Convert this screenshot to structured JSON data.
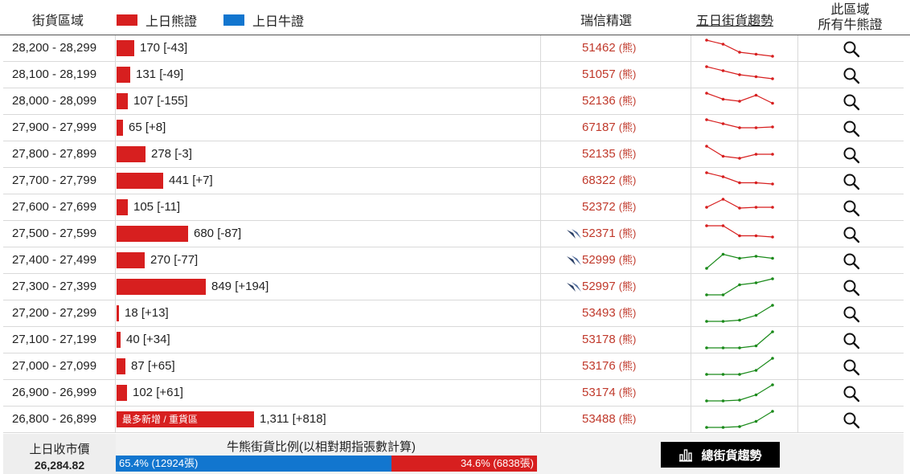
{
  "header": {
    "range_label": "街貨區域",
    "legend_bear": "上日熊證",
    "legend_bull": "上日牛證",
    "pick_label": "瑞信精選",
    "trend_label": "五日街貨趨勢",
    "all_line1": "此區域",
    "all_line2": "所有牛熊證"
  },
  "colors": {
    "bear": "#d71f1f",
    "bull": "#1276cf",
    "bear_trend": "#d71f1f",
    "bull_trend": "#1a8a1a"
  },
  "rows": [
    {
      "range": "28,200 - 28,299",
      "value": 170,
      "text": "170 [-43]",
      "code": "51462",
      "code_suffix": "(熊)",
      "bird": false,
      "trend": [
        5,
        4,
        2,
        1.5,
        1
      ],
      "trend_type": "bear"
    },
    {
      "range": "28,100 - 28,199",
      "value": 131,
      "text": "131 [-49]",
      "code": "51057",
      "code_suffix": "(熊)",
      "bird": false,
      "trend": [
        5,
        4,
        3,
        2.5,
        2
      ],
      "trend_type": "bear"
    },
    {
      "range": "28,000 - 28,099",
      "value": 107,
      "text": "107 [-155]",
      "code": "52136",
      "code_suffix": "(熊)",
      "bird": false,
      "trend": [
        5,
        3.5,
        3,
        4.5,
        2.5
      ],
      "trend_type": "bear"
    },
    {
      "range": "27,900 - 27,999",
      "value": 65,
      "text": "65 [+8]",
      "code": "67187",
      "code_suffix": "(熊)",
      "bird": false,
      "trend": [
        5,
        4,
        3,
        3,
        3.2
      ],
      "trend_type": "bear"
    },
    {
      "range": "27,800 - 27,899",
      "value": 278,
      "text": "278 [-3]",
      "code": "52135",
      "code_suffix": "(熊)",
      "bird": false,
      "trend": [
        5,
        2.5,
        2,
        3,
        3
      ],
      "trend_type": "bear"
    },
    {
      "range": "27,700 - 27,799",
      "value": 441,
      "text": "441 [+7]",
      "code": "68322",
      "code_suffix": "(熊)",
      "bird": false,
      "trend": [
        5,
        4,
        2.5,
        2.5,
        2.2
      ],
      "trend_type": "bear"
    },
    {
      "range": "27,600 - 27,699",
      "value": 105,
      "text": "105 [-11]",
      "code": "52372",
      "code_suffix": "(熊)",
      "bird": false,
      "trend": [
        3,
        5,
        2.8,
        3,
        3
      ],
      "trend_type": "bear"
    },
    {
      "range": "27,500 - 27,599",
      "value": 680,
      "text": "680 [-87]",
      "code": "52371",
      "code_suffix": "(熊)",
      "bird": true,
      "trend": [
        5,
        5,
        2.5,
        2.5,
        2.2
      ],
      "trend_type": "bear"
    },
    {
      "range": "27,400 - 27,499",
      "value": 270,
      "text": "270 [-77]",
      "code": "52999",
      "code_suffix": "(熊)",
      "bird": true,
      "trend": [
        1,
        4.5,
        3.5,
        4,
        3.5
      ],
      "trend_type": "bull"
    },
    {
      "range": "27,300 - 27,399",
      "value": 849,
      "text": "849 [+194]",
      "code": "52997",
      "code_suffix": "(熊)",
      "bird": true,
      "trend": [
        1,
        1,
        3.5,
        4,
        5
      ],
      "trend_type": "bull"
    },
    {
      "range": "27,200 - 27,299",
      "value": 18,
      "text": "18 [+13]",
      "code": "53493",
      "code_suffix": "(熊)",
      "bird": false,
      "trend": [
        1,
        1,
        1.3,
        2.5,
        5
      ],
      "trend_type": "bull"
    },
    {
      "range": "27,100 - 27,199",
      "value": 40,
      "text": "40 [+34]",
      "code": "53178",
      "code_suffix": "(熊)",
      "bird": false,
      "trend": [
        1,
        1,
        1,
        1.5,
        5
      ],
      "trend_type": "bull"
    },
    {
      "range": "27,000 - 27,099",
      "value": 87,
      "text": "87 [+65]",
      "code": "53176",
      "code_suffix": "(熊)",
      "bird": false,
      "trend": [
        1,
        1,
        1,
        2,
        5
      ],
      "trend_type": "bull"
    },
    {
      "range": "26,900 - 26,999",
      "value": 102,
      "text": "102 [+61]",
      "code": "53174",
      "code_suffix": "(熊)",
      "bird": false,
      "trend": [
        1,
        1,
        1.2,
        2.5,
        5
      ],
      "trend_type": "bull"
    },
    {
      "range": "26,800 - 26,899",
      "value": 1311,
      "text": "1,311 [+818]",
      "code": "53488",
      "code_suffix": "(熊)",
      "bird": false,
      "trend": [
        1,
        1,
        1.2,
        2.5,
        5
      ],
      "trend_type": "bull",
      "tag": "最多新增 / 重貨區"
    }
  ],
  "footer": {
    "close_label": "上日收市價",
    "close_value": "26,284.82",
    "ratio_title": "牛熊街貨比例(以相對期指張數計算)",
    "bull_pct": 65.4,
    "bull_text": "65.4% (12924張)",
    "bear_text": "34.6% (6838張)",
    "trend_button": "總街貨趨勢"
  }
}
